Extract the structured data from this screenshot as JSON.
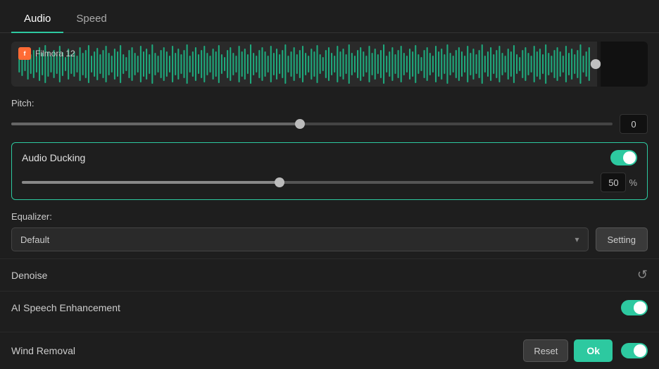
{
  "tabs": [
    {
      "id": "audio",
      "label": "Audio",
      "active": true
    },
    {
      "id": "speed",
      "label": "Speed",
      "active": false
    }
  ],
  "waveform": {
    "app_name": "Filmora 12"
  },
  "pitch": {
    "label": "Pitch:",
    "value": "0",
    "thumb_position_pct": 48
  },
  "audio_ducking": {
    "label": "Audio Ducking",
    "enabled": true,
    "value": "50",
    "percent": "%",
    "thumb_position_pct": 45
  },
  "equalizer": {
    "label": "Equalizer:",
    "default_option": "Default",
    "setting_btn": "Setting"
  },
  "denoise": {
    "label": "Denoise"
  },
  "ai_speech_enhancement": {
    "label": "AI Speech Enhancement",
    "enabled": true
  },
  "wind_removal": {
    "label": "Wind Removal",
    "enabled": true
  },
  "footer": {
    "reset_label": "Reset",
    "ok_label": "Ok"
  }
}
